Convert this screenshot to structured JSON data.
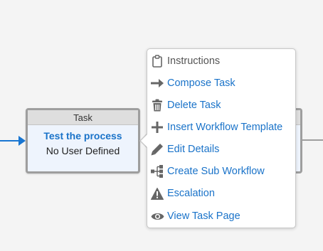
{
  "task_node": {
    "header": "Task",
    "title": "Test the process",
    "assignee": "No User Defined"
  },
  "context_menu": {
    "items": [
      {
        "label": "Instructions",
        "icon": "clipboard-icon",
        "enabled": false
      },
      {
        "label": "Compose Task",
        "icon": "arrow-right-icon",
        "enabled": true
      },
      {
        "label": "Delete Task",
        "icon": "trash-icon",
        "enabled": true
      },
      {
        "label": "Insert Workflow Template",
        "icon": "plus-icon",
        "enabled": true
      },
      {
        "label": "Edit Details",
        "icon": "pencil-icon",
        "enabled": true
      },
      {
        "label": "Create Sub Workflow",
        "icon": "sitemap-icon",
        "enabled": true
      },
      {
        "label": "Escalation",
        "icon": "warning-icon",
        "enabled": true
      },
      {
        "label": "View Task Page",
        "icon": "eye-icon",
        "enabled": true
      }
    ]
  },
  "colors": {
    "link": "#1a73c9",
    "connector_incoming": "#1976d2",
    "node_border": "#9e9e9e"
  }
}
